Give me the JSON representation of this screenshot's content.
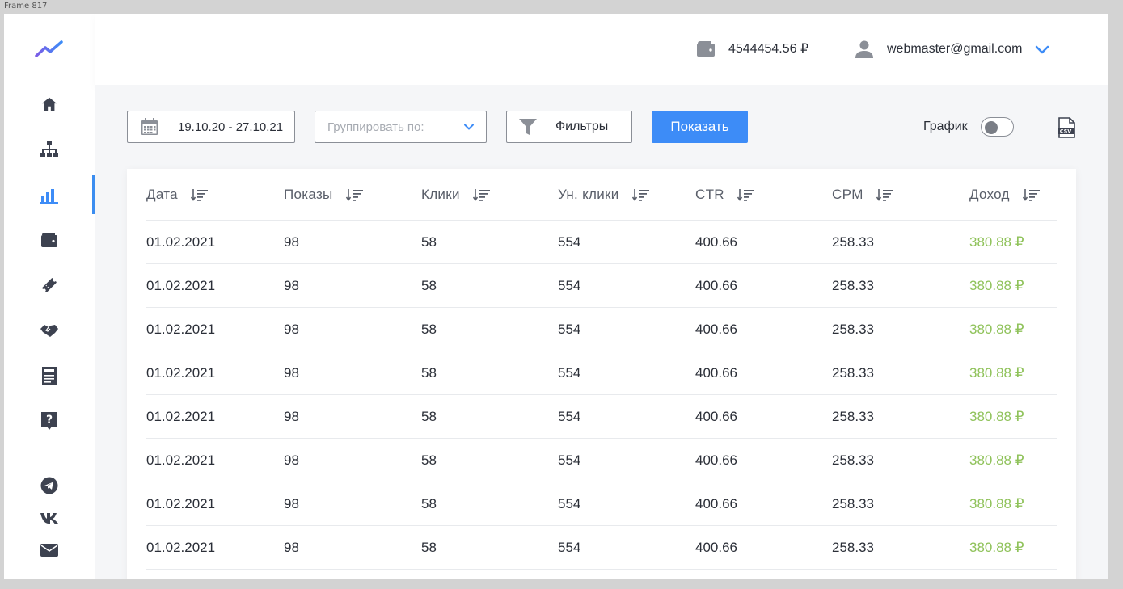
{
  "frame_label": "Frame 817",
  "header": {
    "balance": "4544454.56 ₽",
    "user_email": "webmaster@gmail.com"
  },
  "sidebar": {
    "items": [
      {
        "icon": "home-icon",
        "active": false
      },
      {
        "icon": "sitemap-icon",
        "active": false
      },
      {
        "icon": "bar-chart-icon",
        "active": true
      },
      {
        "icon": "wallet-icon",
        "active": false
      },
      {
        "icon": "ticket-icon",
        "active": false
      },
      {
        "icon": "handshake-icon",
        "active": false
      },
      {
        "icon": "newspaper-icon",
        "active": false
      },
      {
        "icon": "help-icon",
        "active": false
      }
    ],
    "social": [
      {
        "icon": "telegram-icon"
      },
      {
        "icon": "vk-icon"
      },
      {
        "icon": "mail-icon"
      }
    ]
  },
  "toolbar": {
    "date_range": "19.10.20 - 27.10.21",
    "group_placeholder": "Группировать по:",
    "filters_label": "Фильтры",
    "show_label": "Показать",
    "chart_label": "График",
    "chart_toggle_on": false
  },
  "table": {
    "columns": [
      "Дата",
      "Показы",
      "Клики",
      "Ун. клики",
      "CTR",
      "CPM",
      "Доход"
    ],
    "rows": [
      [
        "01.02.2021",
        "98",
        "58",
        "554",
        "400.66",
        "258.33",
        "380.88 ₽"
      ],
      [
        "01.02.2021",
        "98",
        "58",
        "554",
        "400.66",
        "258.33",
        "380.88 ₽"
      ],
      [
        "01.02.2021",
        "98",
        "58",
        "554",
        "400.66",
        "258.33",
        "380.88 ₽"
      ],
      [
        "01.02.2021",
        "98",
        "58",
        "554",
        "400.66",
        "258.33",
        "380.88 ₽"
      ],
      [
        "01.02.2021",
        "98",
        "58",
        "554",
        "400.66",
        "258.33",
        "380.88 ₽"
      ],
      [
        "01.02.2021",
        "98",
        "58",
        "554",
        "400.66",
        "258.33",
        "380.88 ₽"
      ],
      [
        "01.02.2021",
        "98",
        "58",
        "554",
        "400.66",
        "258.33",
        "380.88 ₽"
      ],
      [
        "01.02.2021",
        "98",
        "58",
        "554",
        "400.66",
        "258.33",
        "380.88 ₽"
      ]
    ]
  },
  "colors": {
    "accent": "#3d8cf7",
    "income": "#8fc25a",
    "icon_dark": "#3d4250"
  }
}
